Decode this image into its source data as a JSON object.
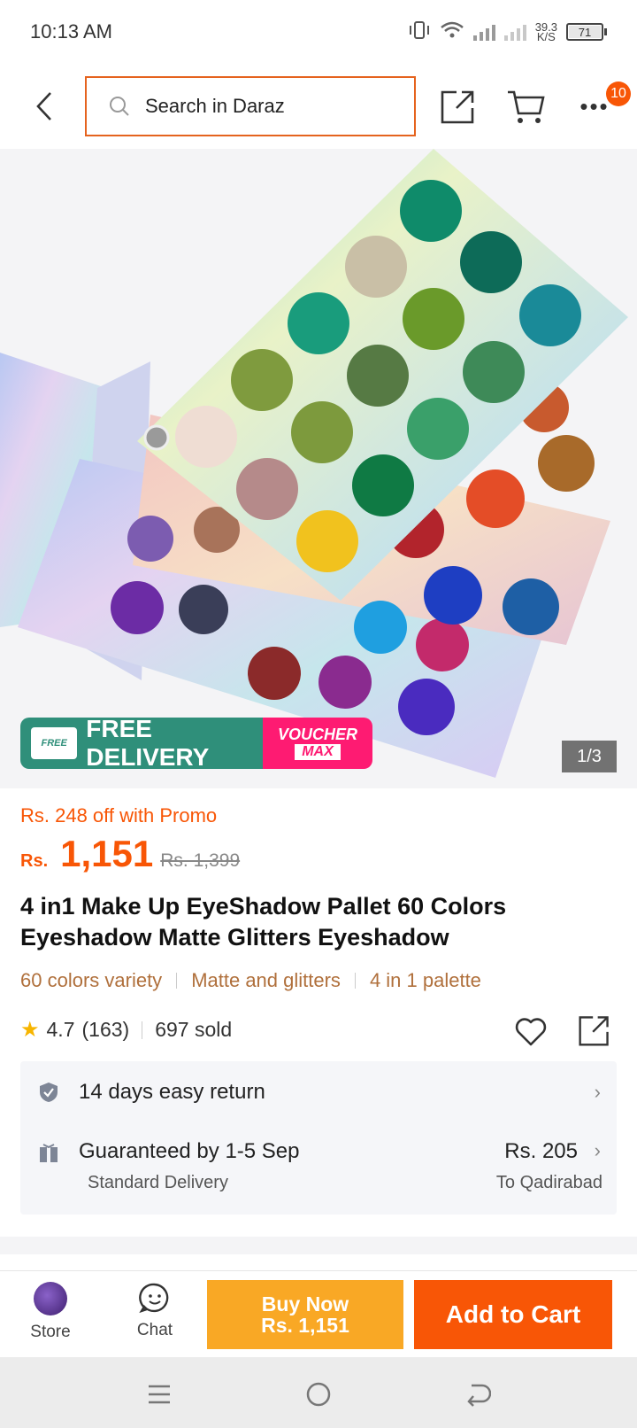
{
  "status_bar": {
    "time": "10:13 AM",
    "net_speed_value": "39.3",
    "net_speed_unit": "K/S",
    "battery": "71"
  },
  "header": {
    "search_placeholder": "Search in Daraz",
    "cart_badge": "10"
  },
  "gallery": {
    "promo_free_tag": "FREE",
    "promo_delivery": "FREE DELIVERY",
    "promo_voucher_1": "VOUCHER",
    "promo_voucher_2": "MAX",
    "counter": "1/3"
  },
  "product": {
    "promo_text": "Rs. 248 off with Promo",
    "currency": "Rs.",
    "price": "1,151",
    "original_price": "Rs. 1,399",
    "title": "4 in1 Make Up EyeShadow Pallet 60 Colors Eyeshadow Matte Glitters Eyeshadow",
    "tags": [
      "60 colors variety",
      "Matte and glitters",
      "4 in 1 palette"
    ],
    "rating": "4.7",
    "reviews": "(163)",
    "sold": "697 sold"
  },
  "services": {
    "return_text": "14 days easy return",
    "delivery_text": "Guaranteed by 1-5 Sep",
    "delivery_type": "Standard Delivery",
    "delivery_fee": "Rs. 205",
    "delivery_dest": "To Qadirabad"
  },
  "action_bar": {
    "store_label": "Store",
    "chat_label": "Chat",
    "buy_now_line1": "Buy Now",
    "buy_now_line2": "Rs. 1,151",
    "add_to_cart": "Add to Cart"
  },
  "colors": {
    "brand_orange": "#f85606",
    "buy_now_yellow": "#f9a825",
    "voucher_pink": "#fe1b72",
    "free_delivery_green": "#2f8f7a"
  }
}
